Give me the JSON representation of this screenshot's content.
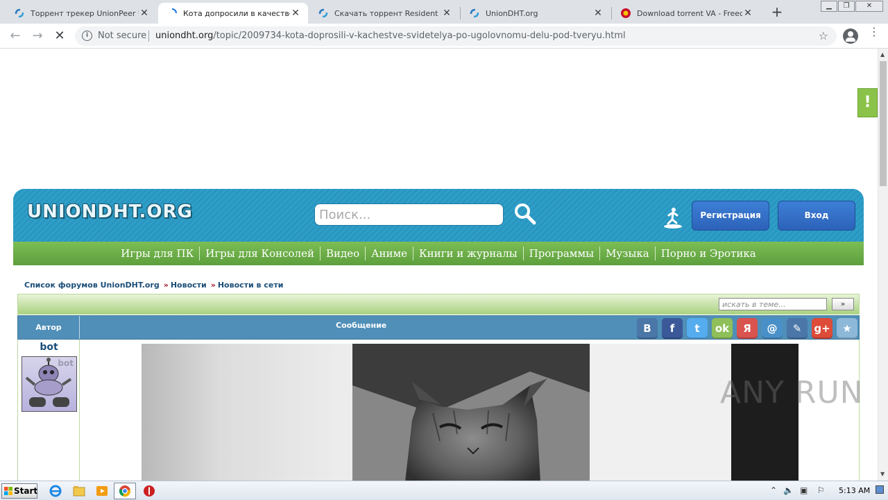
{
  "browser": {
    "tabs": [
      {
        "title": "Торрент трекер UnionPeer Uni",
        "active": false
      },
      {
        "title": "Кота допросили в качестве св",
        "active": true
      },
      {
        "title": "Скачать торрент Resident Evil",
        "active": false
      },
      {
        "title": "UnionDHT.org",
        "active": false
      },
      {
        "title": "Download torrent VA - Freedom",
        "active": false
      }
    ],
    "security_label": "Not secure",
    "url_host": "uniondht.org",
    "url_path": "/topic/2009734-kota-doprosili-v-kachestve-svidetelya-po-ugolovnomu-delu-pod-tveryu.html"
  },
  "site": {
    "logo": "UNIONDHT.ORG",
    "search_placeholder": "Поиск...",
    "register_label": "Регистрация",
    "login_label": "Вход",
    "nav": [
      "Игры для ПК",
      "Игры для Консолей",
      "Видео",
      "Аниме",
      "Книги и журналы",
      "Программы",
      "Музыка",
      "Порно и Эротика"
    ],
    "breadcrumbs": [
      "Список форумов UnionDHT.org",
      "Новости",
      "Новости в сети"
    ],
    "breadcrumb_sep": "»",
    "topic_search_placeholder": "искать в теме...",
    "topic_search_button": "»",
    "feedback_label": "!"
  },
  "post_table": {
    "author_header": "Автор",
    "message_header": "Сообщение",
    "author_name": "bot",
    "avatar_label": "bot",
    "share_buttons": [
      {
        "name": "vk",
        "glyph": "B",
        "color": "#4a76a8"
      },
      {
        "name": "facebook",
        "glyph": "f",
        "color": "#3b5998"
      },
      {
        "name": "twitter",
        "glyph": "t",
        "color": "#55acee"
      },
      {
        "name": "odnoklassniki",
        "glyph": "ok",
        "color": "#8fbf58"
      },
      {
        "name": "yandex",
        "glyph": "Я",
        "color": "#d9534f"
      },
      {
        "name": "mail",
        "glyph": "@",
        "color": "#4a90c8"
      },
      {
        "name": "livejournal",
        "glyph": "✎",
        "color": "#4a76a8"
      },
      {
        "name": "google-plus",
        "glyph": "g+",
        "color": "#dd4b39"
      },
      {
        "name": "bookmark",
        "glyph": "★",
        "color": "#8db8d8"
      }
    ]
  },
  "watermark": "ANY RUN",
  "taskbar": {
    "start_label": "Start",
    "clock": "5:13 AM"
  }
}
